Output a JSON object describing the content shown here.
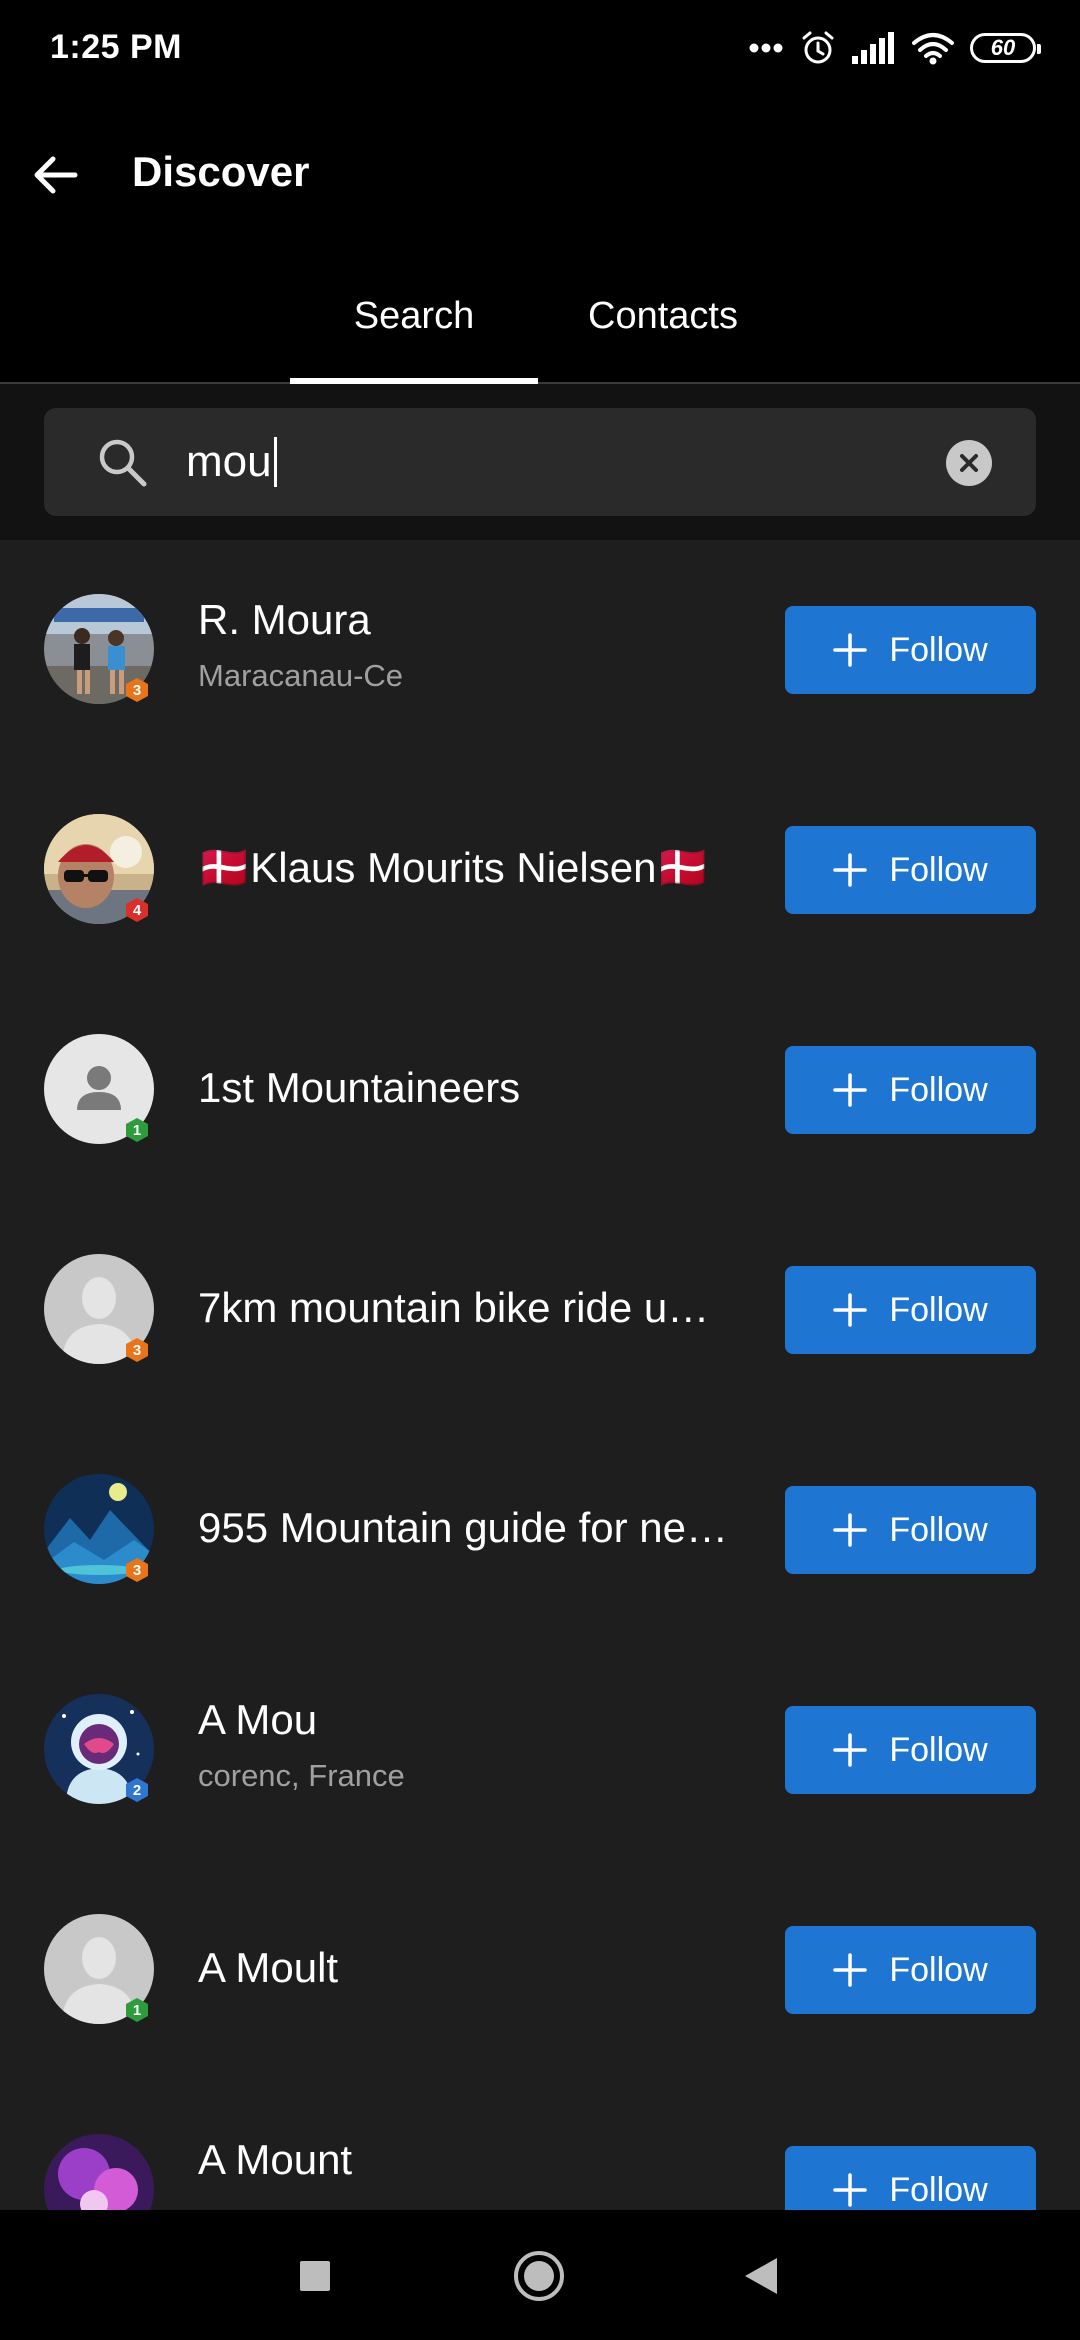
{
  "status_bar": {
    "time": "1:25 PM",
    "battery": "60"
  },
  "app_bar": {
    "title": "Discover"
  },
  "tabs": [
    {
      "label": "Search",
      "selected": true
    },
    {
      "label": "Contacts",
      "selected": false
    }
  ],
  "search": {
    "value": "mou"
  },
  "follow_label": "Follow",
  "results": [
    {
      "name": "R. Moura",
      "subtitle": "Maracanau-Ce",
      "badge": "3",
      "badge_color": "#e8751a",
      "avatar": "photo-runners"
    },
    {
      "name": "🇩🇰Klaus Mourits Nielsen🇩🇰",
      "subtitle": "",
      "badge": "4",
      "badge_color": "#d9302b",
      "avatar": "photo-selfie"
    },
    {
      "name": "1st Mountaineers",
      "subtitle": "",
      "badge": "1",
      "badge_color": "#2e9b3c",
      "avatar": "default-person"
    },
    {
      "name": "7km mountain bike ride u…",
      "subtitle": "",
      "badge": "3",
      "badge_color": "#e8751a",
      "avatar": "default-silhouette"
    },
    {
      "name": "955 Mountain guide for ne…",
      "subtitle": "",
      "badge": "3",
      "badge_color": "#e8751a",
      "avatar": "mountain-night"
    },
    {
      "name": "A Mou",
      "subtitle": "corenc, France",
      "badge": "2",
      "badge_color": "#2f76d0",
      "avatar": "astronaut"
    },
    {
      "name": "A Moult",
      "subtitle": "",
      "badge": "1",
      "badge_color": "#2e9b3c",
      "avatar": "default-silhouette"
    },
    {
      "name": "A Mount",
      "subtitle": "",
      "badge": "",
      "badge_color": "#e8751a",
      "avatar": "purple-art"
    }
  ]
}
